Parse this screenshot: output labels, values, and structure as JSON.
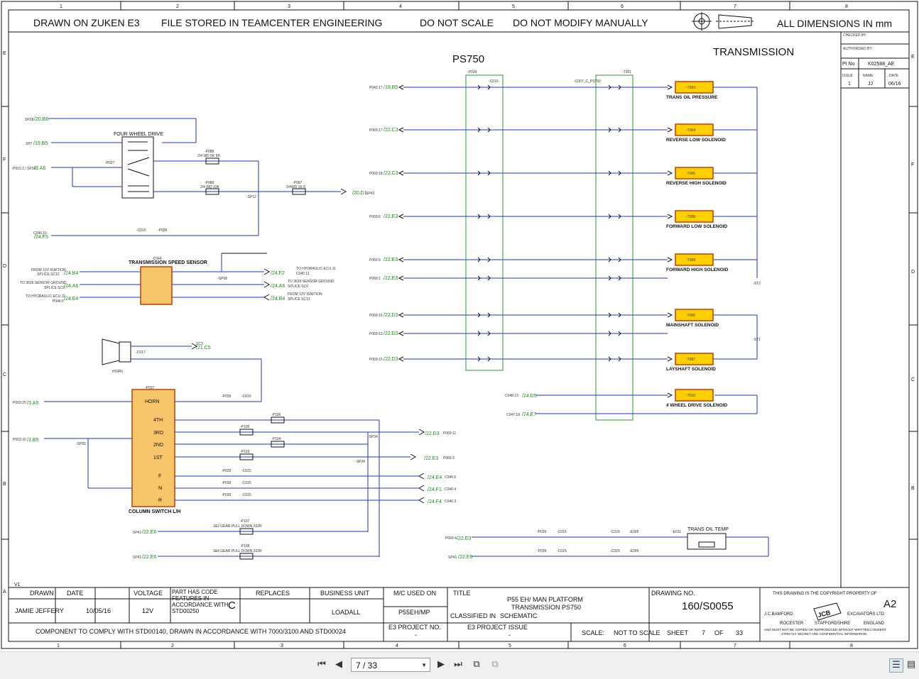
{
  "drawing": {
    "grid_cols": [
      "1",
      "2",
      "3",
      "4",
      "5",
      "6",
      "7",
      "8"
    ],
    "grid_rows": [
      "E",
      "F",
      "D",
      "C",
      "B",
      "A"
    ],
    "header": {
      "drawn_on": "DRAWN ON ZUKEN E3",
      "file_stored": "FILE STORED IN TEAMCENTER ENGINEERING",
      "do_not_scale": "DO NOT SCALE",
      "do_not_modify": "DO NOT MODIFY MANUALLY",
      "dimensions": "ALL DIMENSIONS IN mm"
    },
    "title_ps750": "PS750",
    "title_transmission": "TRANSMISSION",
    "revision_block": {
      "checked_by": "CHECKED BY:",
      "authorised_by": "AUTHORISED BY:",
      "pi_no_label": "PI No",
      "pi_no_value": "K02588_AE",
      "issue_label": "ISSUE",
      "name_label": "NAME",
      "date_label": "DATE",
      "issue_value": "1",
      "name_value": "JJ",
      "date_value": "06/16"
    },
    "left_circuit": {
      "sp28": "SP28",
      "sp28_ref": "/20.B6",
      "sp7": "SP7",
      "sp7_ref": "/19.B5",
      "p001_sp20": "P001:2 / SP20",
      "p001_ref": "/3.A6",
      "four_wheel_drive": "FOUR WHEEL DRIVE",
      "p027": "-P027",
      "p088": "-P088",
      "p088_val": "2/4 WD 5K 6R",
      "p089": "-P089",
      "p089_val": "2/4 WD 33K",
      "p087": "-P087",
      "p087_val": "2/4WD 1K 8",
      "sp12": "-SP12",
      "sp42": "SP42",
      "sp42_ref": "/20.D1",
      "c046_10": "C046:10",
      "c046_ref": "/24.F5",
      "c015": "-C015",
      "p039": "-P039",
      "c044": "-C044",
      "speed_sensor": "TRANSMISSION SPEED SENSOR",
      "from_12v": "FROM 12V IGNITION",
      "splice_sc12": "SPLICE SC12",
      "to_3636": "TO 3636 SENSOR GROUND",
      "splice_sc9": "SPLICE SC9",
      "to_hyd": "TO HYDRAULIC ECU J2",
      "p046s5": "P046:5",
      "ref_b4": "/24.B4",
      "ref_a6": "/24.A6",
      "ref_e4": "/24.E4",
      "sp68": "-SP68",
      "right_to_hyd": "TO HYDRAULIC ECU J1",
      "c045_11": "C045:11",
      "ref_f2": "/24.F2",
      "right_to_3636": "TO 3636 SENSOR GROUND",
      "right_sc9": "SPLICE SC9",
      "ref_a6b": "/24.A6",
      "right_from_12v": "FROM 12V IGNITION",
      "right_sc12": "SPLICE SC12",
      "ref_b4b": "/24.B4",
      "horn": "HORN",
      "c017": "-C017",
      "sc3": "SC3",
      "sc3_ref": "/21.C5",
      "p037": "-P037",
      "p003_20": "P003:20",
      "p003_20_ref": "/3.A5",
      "p003_10": "P003:10",
      "p003_10_ref": "/3.B5",
      "sp65": "-SP65",
      "sw_horn": "HORN",
      "sw_4th": "4TH",
      "sw_3rd": "3RD",
      "sw_2nd": "2ND",
      "sw_1st": "1ST",
      "sw_f": "F",
      "sw_n": "N",
      "sw_r": "R",
      "column_switch": "COLUMN SWITCH L/H",
      "p106": "-P106",
      "p105": "-P105",
      "p104": "-P104",
      "p103": "-P103",
      "sp34": "-SP34",
      "sp24": "-SP24",
      "ref_d3": "/22.D3",
      "p069_11": "P069:11",
      "ref_e3": "/22.E3",
      "p069_3": "P069:3",
      "ref_e4b": "/24.E4",
      "c046_9": "C046:9",
      "ref_f1": "/24.F1",
      "c046_4": "C046:4",
      "ref_f4": "/24.F4",
      "c046_3": "C046:3",
      "p107": "-P107",
      "gear12": "1&2 GEAR PULL DOWN 332R",
      "p108": "-P108",
      "gear34": "3&4 GEAR PULL DOWN 332R",
      "sp41_a": "SP41",
      "sp41_ref_a": "/22.E6",
      "sp41_b": "SP41",
      "sp41_ref_b": "/22.E6"
    },
    "connectors": {
      "p039_top": "-P039",
      "c015_top": "-C015",
      "c007": "-C007_C_PS750",
      "t001": "-T001"
    },
    "left_refs": [
      {
        "id": "P042:17",
        "ref": "/19.B5"
      },
      {
        "id": "P069:17",
        "ref": "/22.C3"
      },
      {
        "id": "P069:18",
        "ref": "/22.C3"
      },
      {
        "id": "P069:6",
        "ref": "/22.E3"
      },
      {
        "id": "P069:5",
        "ref": "/22.E3"
      },
      {
        "id": "P069:1",
        "ref": "/22.E3"
      },
      {
        "id": "P069:16",
        "ref": "/22.D3"
      },
      {
        "id": "P069:13",
        "ref": "/22.D3"
      },
      {
        "id": "P069:15",
        "ref": "/22.D3"
      }
    ],
    "solenoids": [
      {
        "tag": "-T003",
        "name": "TRANS OIL PRESSURE"
      },
      {
        "tag": "-T004",
        "name": "REVERSE LOW SOLENOID"
      },
      {
        "tag": "-T005",
        "name": "REVERSE HIGH SOLENOID"
      },
      {
        "tag": "-T008",
        "name": "FORWARD LOW SOLENOID"
      },
      {
        "tag": "-T009",
        "name": "FORWARD HIGH SOLENOID"
      },
      {
        "tag": "-T006",
        "name": "MAINSHAFT SOLENOID"
      },
      {
        "tag": "-T007",
        "name": "LAYSHAFT SOLENOID"
      },
      {
        "tag": "-T010",
        "name": "4 WHEEL DRIVE SOLENOID"
      }
    ],
    "sp_labels": {
      "st2": "-ST2",
      "st1": "-ST1"
    },
    "wd_refs": [
      {
        "id": "C048:13",
        "ref": "/24.D5"
      },
      {
        "id": "C047:18",
        "ref": "/24.E7"
      }
    ],
    "oil_temp": {
      "p069_4": "P069:4",
      "p069_4_ref": "/22.E3",
      "sp41": "SP41",
      "sp41_ref": "/22.E6",
      "p039": "-P039",
      "c015": "-C015",
      "c029": "-C029",
      "e009": "-E009",
      "e011": "-E011",
      "sensor": "TRANS OIL TEMP"
    },
    "v1": "V1",
    "title_block": {
      "drawn_h": "DRAWN",
      "date_h": "DATE",
      "voltage_h": "VOLTAGE",
      "part_note": "PART HAS CODE FEATURES IN ACCORDANCE WITH STD00250",
      "code": "C",
      "replaces_h": "REPLACES",
      "bu_h": "BUSINESS UNIT",
      "mc_h": "M/C USED ON",
      "title_h": "TITLE",
      "drawn_v": "JAMIE JEFFERY",
      "date_v": "10/05/16",
      "voltage_v": "12V",
      "bu_v": "LOADALL",
      "mc_v": "P55EH/MP",
      "title_l1": "P55 EH/ MAN PLATFORM",
      "title_l2": "TRANSMISSION PS750",
      "classified_l": "CLASSIFIED IN",
      "classified_v": "SCHEMATIC",
      "drawing_no_h": "DRAWING NO.",
      "drawing_no_v": "160/S0055",
      "copyright": "THIS DRAWING IS THE COPYRIGHT PROPERTY OF",
      "size": "A2",
      "jcb_name": "J.C.BAMFORD",
      "excavators": "EXCAVATORS LTD",
      "rocester": "ROCESTER",
      "staffordshire": "STAFFORDSHIRE",
      "england": "ENGLAND",
      "fine1": "AND MUST NOT BE COPIED OR REPRODUCED WITHOUT WRITTEN CONSENT.",
      "fine2": "STRICTLY SECRET AND CONFIDENTIAL INFORMATION",
      "jcb_logo": "JCB",
      "comply": "COMPONENT TO COMPLY WITH STD00140, DRAWN IN ACCORDANCE WITH 7000/3100 AND STD00024",
      "e3_project": "E3 PROJECT NO.",
      "e3_project_v": "-",
      "e3_issue": "E3 PROJECT ISSUE",
      "e3_issue_v": "-",
      "scale_l": "SCALE:",
      "scale_v": "NOT TO SCALE",
      "sheet_l": "SHEET",
      "sheet_v": "7",
      "of_l": "OF",
      "of_v": "33"
    }
  },
  "toolbar": {
    "page_value": "7 / 33",
    "icons": [
      "first-page-icon",
      "previous-page-icon",
      "next-page-icon",
      "last-page-icon",
      "fit-page-icon",
      "fit-width-icon",
      "single-page-view-icon",
      "continuous-view-icon"
    ]
  }
}
